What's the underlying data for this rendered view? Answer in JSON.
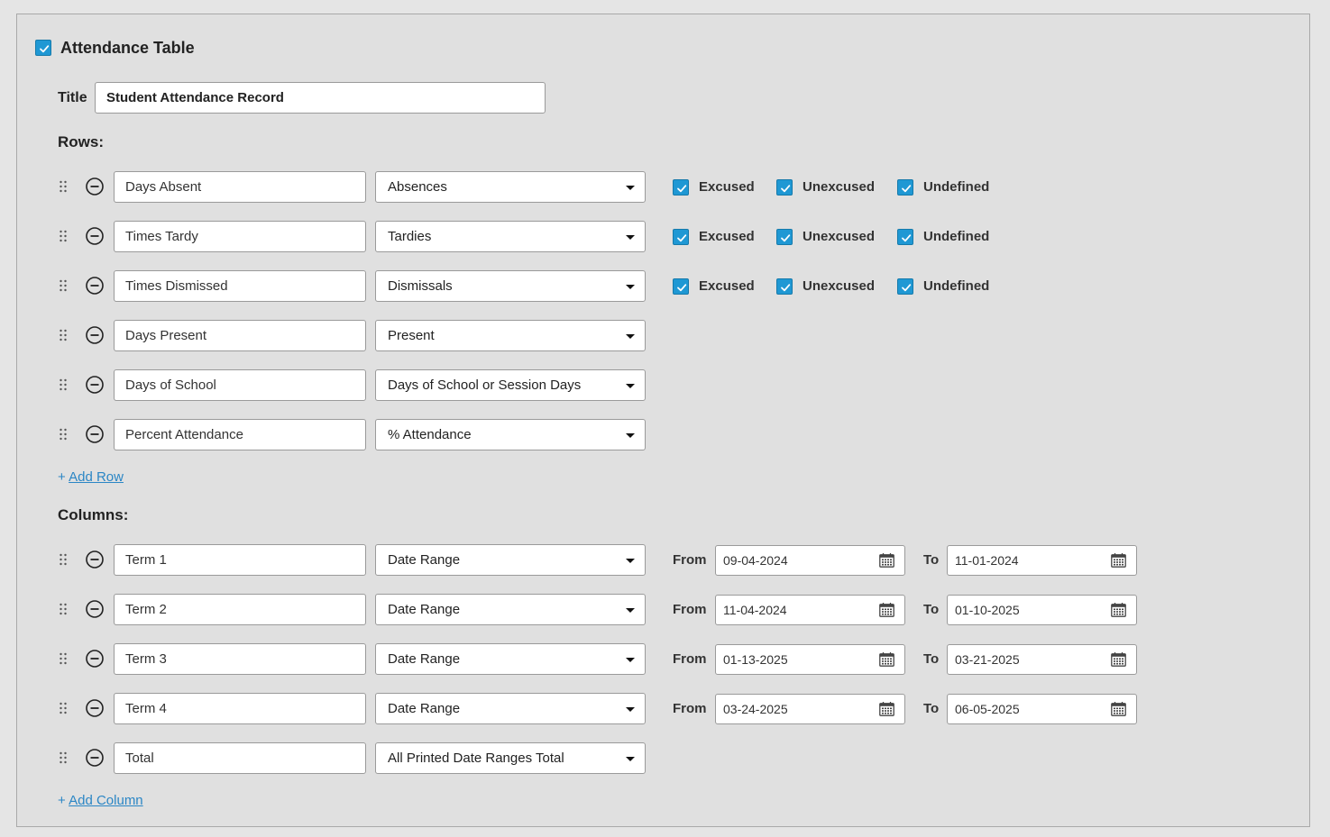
{
  "section": {
    "title": "Attendance Table",
    "checked": true
  },
  "title_field": {
    "label": "Title",
    "value": "Student Attendance Record"
  },
  "rows_heading": "Rows:",
  "rows": [
    {
      "label": "Days Absent",
      "type": "Absences",
      "excused": "Excused",
      "unexcused": "Unexcused",
      "undefined": "Undefined"
    },
    {
      "label": "Times Tardy",
      "type": "Tardies",
      "excused": "Excused",
      "unexcused": "Unexcused",
      "undefined": "Undefined"
    },
    {
      "label": "Times Dismissed",
      "type": "Dismissals",
      "excused": "Excused",
      "unexcused": "Unexcused",
      "undefined": "Undefined"
    },
    {
      "label": "Days Present",
      "type": "Present"
    },
    {
      "label": "Days of School",
      "type": "Days of School or Session Days"
    },
    {
      "label": "Percent Attendance",
      "type": "% Attendance"
    }
  ],
  "add_row": {
    "plus": "+",
    "label": "Add Row"
  },
  "columns_heading": "Columns:",
  "columns": [
    {
      "label": "Term 1",
      "type": "Date Range",
      "from_label": "From",
      "from": "09-04-2024",
      "to_label": "To",
      "to": "11-01-2024"
    },
    {
      "label": "Term 2",
      "type": "Date Range",
      "from_label": "From",
      "from": "11-04-2024",
      "to_label": "To",
      "to": "01-10-2025"
    },
    {
      "label": "Term 3",
      "type": "Date Range",
      "from_label": "From",
      "from": "01-13-2025",
      "to_label": "To",
      "to": "03-21-2025"
    },
    {
      "label": "Term 4",
      "type": "Date Range",
      "from_label": "From",
      "from": "03-24-2025",
      "to_label": "To",
      "to": "06-05-2025"
    },
    {
      "label": "Total",
      "type": "All Printed Date Ranges Total"
    }
  ],
  "add_column": {
    "plus": "+",
    "label": "Add Column"
  },
  "colors": {
    "accent": "#1f98d4",
    "link": "#2b86c5",
    "panel": "#e0e0e0"
  }
}
